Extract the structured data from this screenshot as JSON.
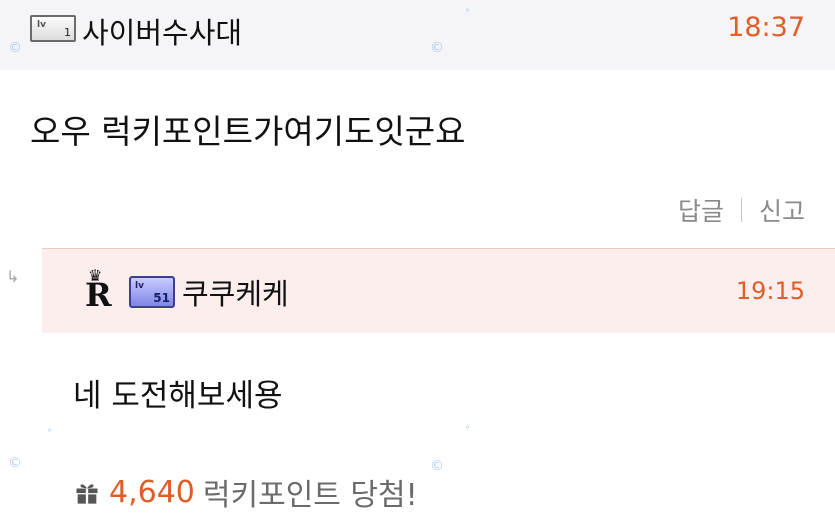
{
  "comment": {
    "level_badge": {
      "lv": "lv",
      "num": "1"
    },
    "author": "사이버수사대",
    "time": "18:37",
    "body": "오우 럭키포인트가여기도잇군요",
    "actions": {
      "reply": "답글",
      "report": "신고"
    }
  },
  "reply": {
    "arrow": "↳",
    "level_badge": {
      "lv": "lv",
      "num": "51"
    },
    "author": "쿠쿠케케",
    "time": "19:15",
    "body": "네 도전해보세용",
    "reward": {
      "amount": "4,640",
      "text": "럭키포인트 당첨!"
    }
  },
  "icons": {
    "gift": "gift-icon",
    "rank_badge": "crown-r-icon"
  },
  "colors": {
    "accent": "#e05d28",
    "header_bg": "#f5f5f7",
    "reply_bg": "#fbeeed"
  }
}
